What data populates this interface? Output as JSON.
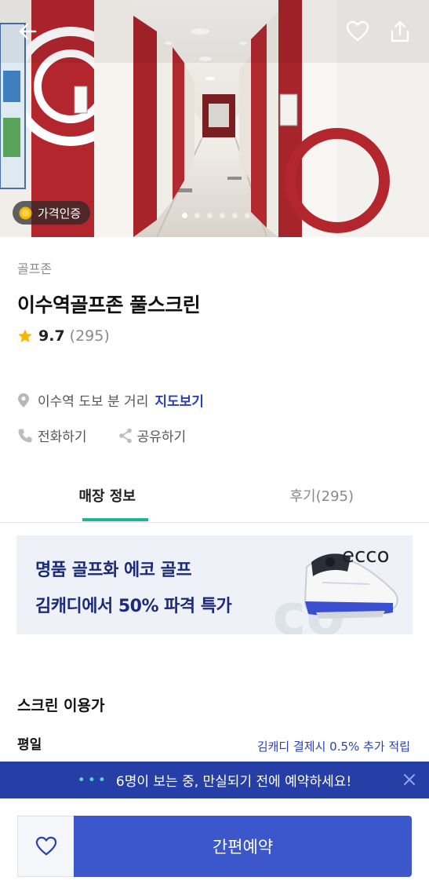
{
  "hero": {
    "badge_label": "가격인증",
    "slide_count": 6,
    "active_slide": 1,
    "icons": {
      "back": "arrow-left-icon",
      "favorite": "heart-icon",
      "share": "share-upload-icon",
      "badge": "gold-coin-icon"
    }
  },
  "store": {
    "category": "골프존",
    "name": "이수역골프존 풀스크린",
    "rating": "9.7",
    "review_count_text": "(295)",
    "location_text": "이수역 도보 분 거리",
    "map_link": "지도보기",
    "call_label": "전화하기",
    "share_label": "공유하기"
  },
  "tabs": [
    {
      "label": "매장 정보",
      "active": true
    },
    {
      "label": "후기(295)",
      "active": false
    }
  ],
  "banner": {
    "line1": "명품 골프화 에코 골프",
    "line2": "김캐디에서 50% 파격 특가",
    "brand": "ecco",
    "watermark": "ecco"
  },
  "pricing": {
    "section_title": "스크린 이용가",
    "weekday_label": "평일",
    "reward_note": "김캐디 결제시 0.5% 추가 적립"
  },
  "notice": {
    "dots": "•••",
    "text": "6명이 보는 중, 만실되기 전에 예약하세요!"
  },
  "bottom_bar": {
    "book_label": "간편예약"
  },
  "colors": {
    "accent_blue": "#3c57cc",
    "notice_blue": "#253fa6",
    "link_blue": "#2a3fb8",
    "tab_indicator": "#1fb49a",
    "star": "#f5b700"
  }
}
